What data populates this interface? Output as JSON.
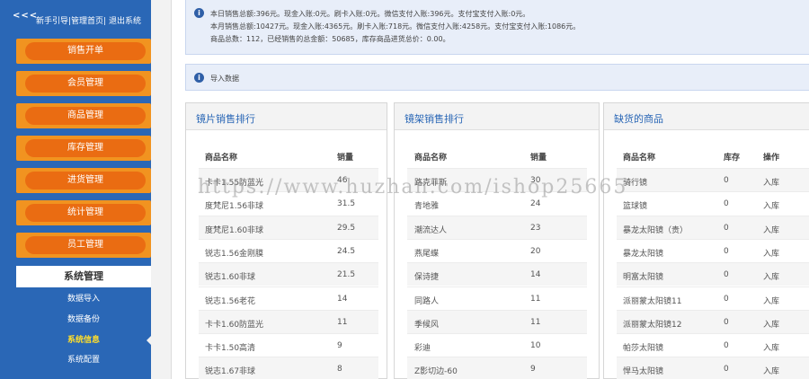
{
  "sidebar": {
    "back": "<<<",
    "top_links": [
      "新手引导",
      "|管理首页",
      "| 退出系统"
    ],
    "menu": [
      "销售开单",
      "会员管理",
      "商品管理",
      "库存管理",
      "进货管理",
      "统计管理",
      "员工管理"
    ],
    "section_title": "系统管理",
    "sub_items": [
      "数据导入",
      "数据备份",
      "系统信息",
      "系统配置"
    ],
    "active_sub": "系统信息"
  },
  "notice": {
    "lines": [
      "本日销售总额:396元。现金入账:0元。刷卡入账:0元。微信支付入账:396元。支付宝支付入账:0元。",
      "本月销售总额:10427元。现金入账:4365元。刷卡入账:718元。微信支付入账:4258元。支付宝支付入账:1086元。",
      "商品总数：112，已经销售的总金额：50685，库存商品进货总价：0.00。"
    ]
  },
  "import_notice": "导入数据",
  "panels": {
    "lens": {
      "title": "镜片销售排行",
      "headers": [
        "商品名称",
        "销量"
      ],
      "rows": [
        [
          "卡卡1.55防蓝光",
          "46"
        ],
        [
          "度梵尼1.56非球",
          "31.5"
        ],
        [
          "度梵尼1.60非球",
          "29.5"
        ],
        [
          "锐志1.56金刚膜",
          "24.5"
        ],
        [
          "锐志1.60非球",
          "21.5"
        ],
        [
          "锐志1.56老花",
          "14"
        ],
        [
          "卡卡1.60防蓝光",
          "11"
        ],
        [
          "卡卡1.50高清",
          "9"
        ],
        [
          "锐志1.67非球",
          "8"
        ]
      ]
    },
    "frame": {
      "title": "镜架销售排行",
      "headers": [
        "商品名称",
        "销量"
      ],
      "rows": [
        [
          "路克菲斯",
          "30"
        ],
        [
          "青地雅",
          "24"
        ],
        [
          "潮流达人",
          "23"
        ],
        [
          "燕尾蝶",
          "20"
        ],
        [
          "保诗捷",
          "14"
        ],
        [
          "同路人",
          "11"
        ],
        [
          "季候风",
          "11"
        ],
        [
          "彩迪",
          "10"
        ],
        [
          "Z影切边-60",
          "9"
        ]
      ]
    },
    "stock": {
      "title": "缺货的商品",
      "headers": [
        "商品名称",
        "库存",
        "操作"
      ],
      "rows": [
        [
          "骑行镜",
          "0",
          "入库"
        ],
        [
          "篮球镜",
          "0",
          "入库"
        ],
        [
          "暴龙太阳镜（贵）",
          "0",
          "入库"
        ],
        [
          "暴龙太阳镜",
          "0",
          "入库"
        ],
        [
          "明富太阳镜",
          "0",
          "入库"
        ],
        [
          "派丽蒙太阳镜11",
          "0",
          "入库"
        ],
        [
          "派丽蒙太阳镜12",
          "0",
          "入库"
        ],
        [
          "帕莎太阳镜",
          "0",
          "入库"
        ],
        [
          "悍马太阳镜",
          "0",
          "入库"
        ]
      ]
    }
  },
  "watermark": "https://www.huzhan.com/ishop25665",
  "colors": {
    "sidebar_bg": "#2a67b6",
    "menu_orange": "#ea6c12",
    "active_sub": "#ffde2a",
    "notice_bg": "#e8eef9",
    "title_blue": "#2a67b6"
  }
}
